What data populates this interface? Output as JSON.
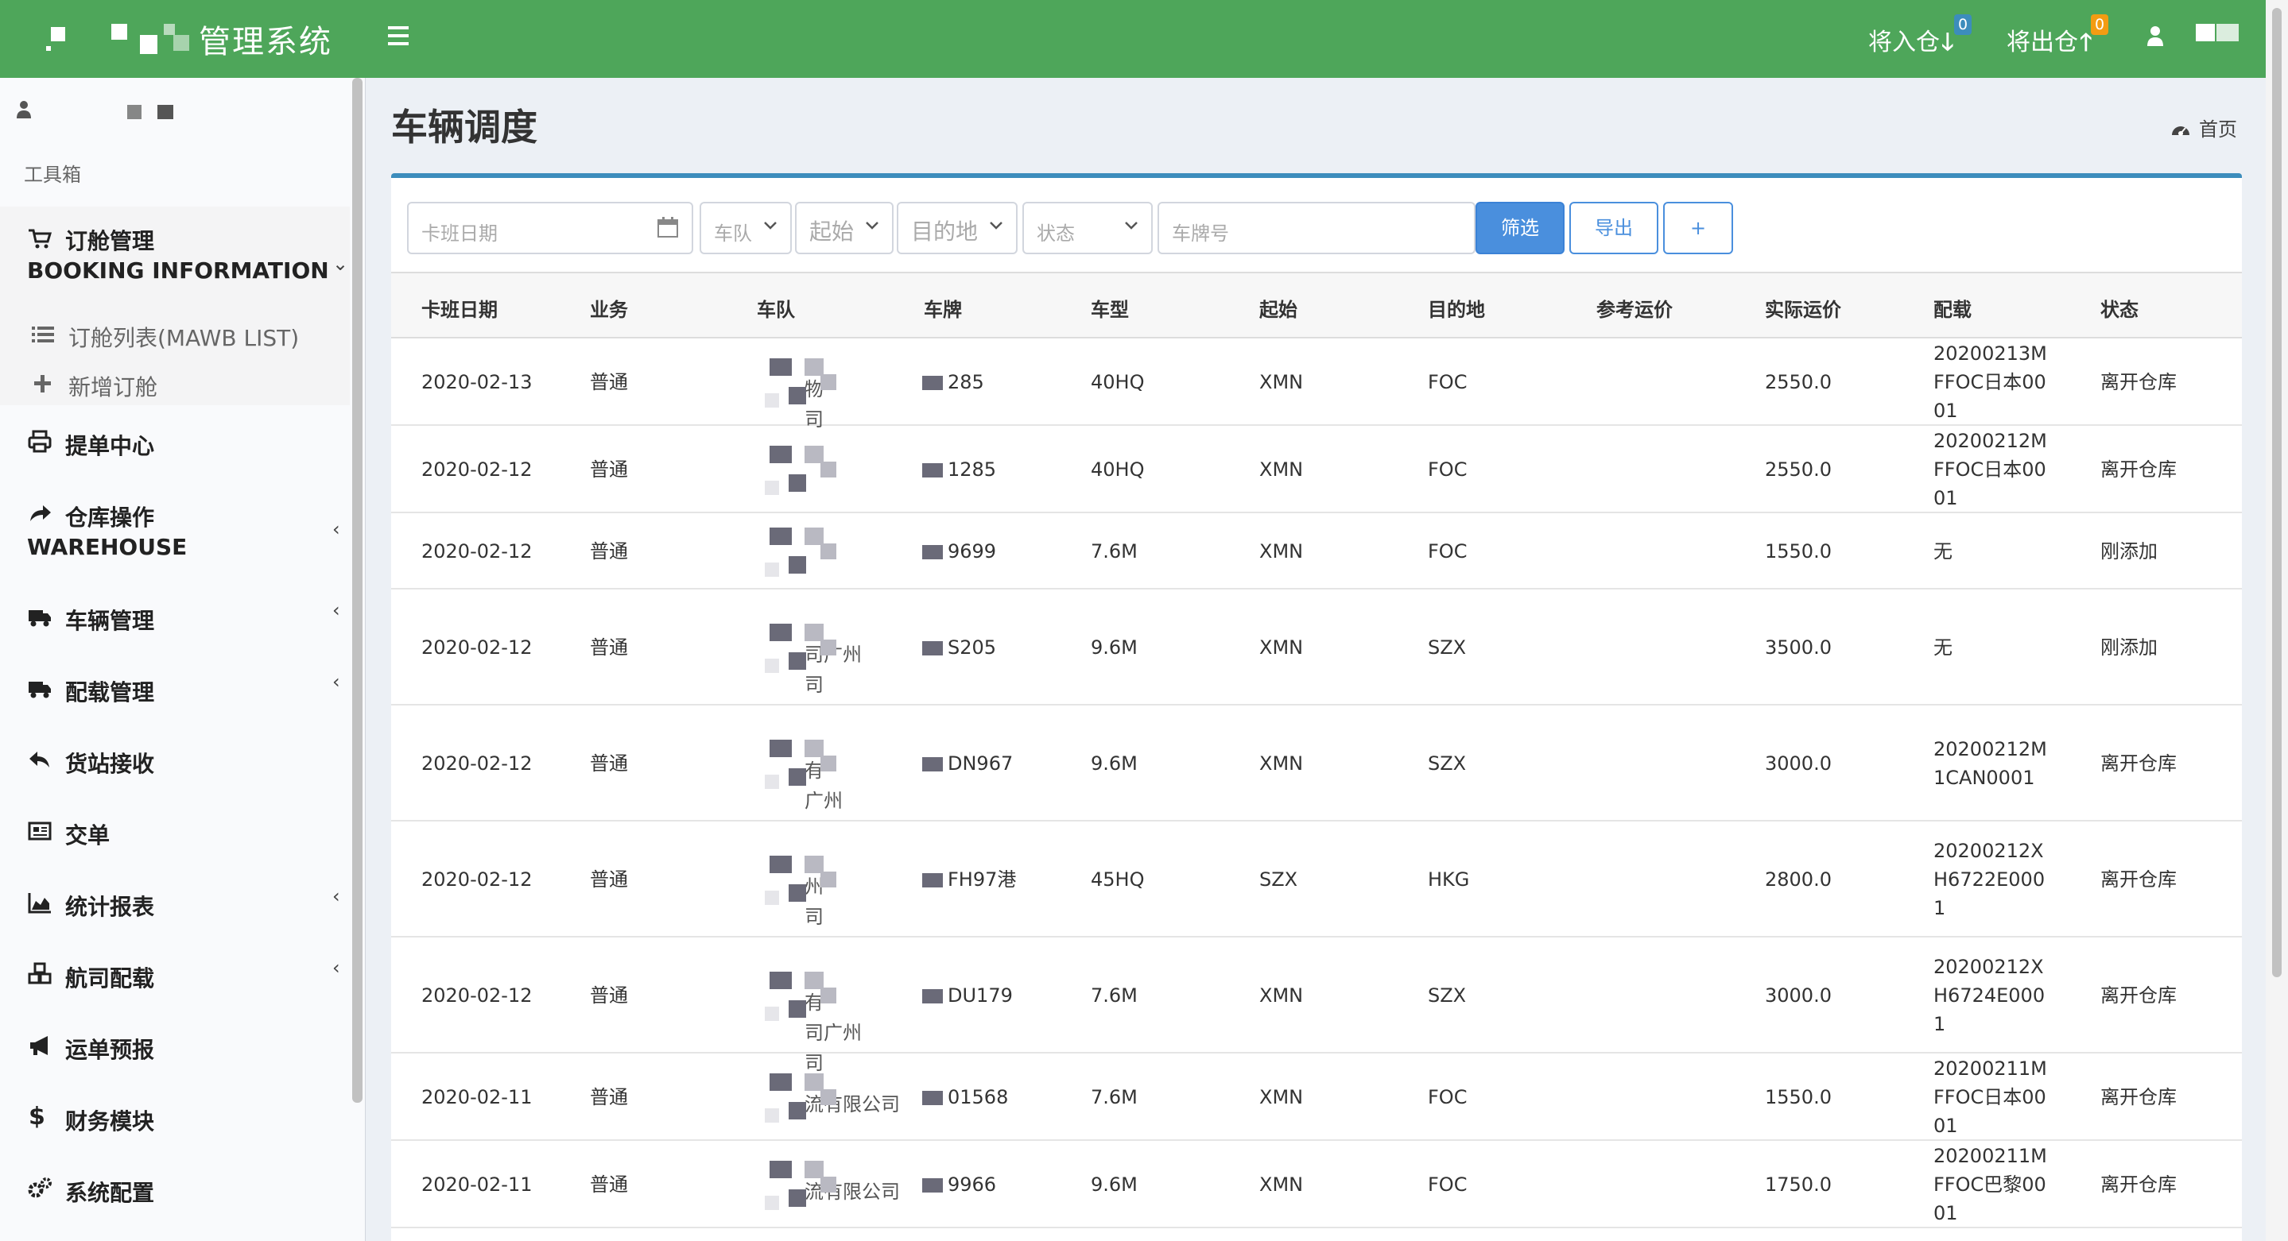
{
  "header": {
    "app_title": "管理系统",
    "nav": {
      "inbound_label": "将入仓",
      "inbound_badge": "0",
      "outbound_label": "将出仓",
      "outbound_badge": "0"
    },
    "colors": {
      "topbar": "#4ea65a",
      "accent": "#3c8dbc",
      "badge_orange": "#f39c12"
    }
  },
  "sidebar": {
    "section_label": "工具箱",
    "booking": {
      "label_cn": "订舱管理",
      "label_en": "BOOKING INFORMATION",
      "icon": "cart-icon"
    },
    "booking_sub": [
      {
        "label": "订舱列表(MAWB LIST)",
        "icon": "list-icon"
      },
      {
        "label": "新增订舱",
        "icon": "plus-icon"
      }
    ],
    "bill_center": {
      "label": "提单中心",
      "icon": "print-icon"
    },
    "warehouse": {
      "label_cn": "仓库操作",
      "label_en": "WAREHOUSE",
      "icon": "share-icon"
    },
    "vehicle": {
      "label": "车辆管理",
      "icon": "truck-icon"
    },
    "loading": {
      "label": "配载管理",
      "icon": "truck-icon"
    },
    "station": {
      "label": "货站接收",
      "icon": "reply-icon"
    },
    "handover": {
      "label": "交单",
      "icon": "newspaper-icon"
    },
    "stats": {
      "label": "统计报表",
      "icon": "area-chart-icon"
    },
    "airline": {
      "label": "航司配载",
      "icon": "cubes-icon"
    },
    "forecast": {
      "label": "运单预报",
      "icon": "bullhorn-icon"
    },
    "finance": {
      "label": "财务模块",
      "icon": "dollar-icon"
    },
    "config": {
      "label": "系统配置",
      "icon": "cogs-icon"
    },
    "chevron_left": "‹",
    "chevron_down": "⌄"
  },
  "page": {
    "title": "车辆调度",
    "breadcrumb_home": "首页"
  },
  "filters": {
    "date_placeholder": "卡班日期",
    "fleet_placeholder": "车队",
    "origin_placeholder": "起始",
    "dest_placeholder": "目的地",
    "status_placeholder": "状态",
    "plate_placeholder": "车牌号",
    "filter_button": "筛选",
    "export_button": "导出",
    "add_button": "+"
  },
  "table": {
    "headers": [
      "卡班日期",
      "业务",
      "车队",
      "车牌",
      "车型",
      "起始",
      "目的地",
      "参考运价",
      "实际运价",
      "配载",
      "状态"
    ],
    "rows": [
      {
        "date": "2020-02-13",
        "biz": "普通",
        "fleet": "物\n司",
        "plate": "285",
        "type": "40HQ",
        "origin": "XMN",
        "dest": "FOC",
        "ref": "",
        "price": "2550.0",
        "load": "20200213M\nFFOC日本00\n01",
        "status": "离开仓库"
      },
      {
        "date": "2020-02-12",
        "biz": "普通",
        "fleet": "",
        "plate": "1285",
        "type": "40HQ",
        "origin": "XMN",
        "dest": "FOC",
        "ref": "",
        "price": "2550.0",
        "load": "20200212M\nFFOC日本00\n01",
        "status": "离开仓库"
      },
      {
        "date": "2020-02-12",
        "biz": "普通",
        "fleet": "",
        "plate": "9699",
        "type": "7.6M",
        "origin": "XMN",
        "dest": "FOC",
        "ref": "",
        "price": "1550.0",
        "load": "无",
        "status": "刚添加"
      },
      {
        "date": "2020-02-12",
        "biz": "普通",
        "fleet": "司广州\n司",
        "plate": "S205",
        "type": "9.6M",
        "origin": "XMN",
        "dest": "SZX",
        "ref": "",
        "price": "3500.0",
        "load": "无",
        "status": "刚添加"
      },
      {
        "date": "2020-02-12",
        "biz": "普通",
        "fleet": "有\n广州",
        "plate": "DN967",
        "type": "9.6M",
        "origin": "XMN",
        "dest": "SZX",
        "ref": "",
        "price": "3000.0",
        "load": "20200212M\n1CAN0001",
        "status": "离开仓库"
      },
      {
        "date": "2020-02-12",
        "biz": "普通",
        "fleet": "州\n司",
        "plate": "FH97港",
        "type": "45HQ",
        "origin": "SZX",
        "dest": "HKG",
        "ref": "",
        "price": "2800.0",
        "load": "20200212X\nH6722E000\n1",
        "status": "离开仓库"
      },
      {
        "date": "2020-02-12",
        "biz": "普通",
        "fleet": "有\n司广州\n司",
        "plate": "DU179",
        "type": "7.6M",
        "origin": "XMN",
        "dest": "SZX",
        "ref": "",
        "price": "3000.0",
        "load": "20200212X\nH6724E000\n1",
        "status": "离开仓库"
      },
      {
        "date": "2020-02-11",
        "biz": "普通",
        "fleet": "流有限公司",
        "plate": "01568",
        "type": "7.6M",
        "origin": "XMN",
        "dest": "FOC",
        "ref": "",
        "price": "1550.0",
        "load": "20200211M\nFFOC日本00\n01",
        "status": "离开仓库"
      },
      {
        "date": "2020-02-11",
        "biz": "普通",
        "fleet": "流有限公司",
        "plate": "9966",
        "type": "9.6M",
        "origin": "XMN",
        "dest": "FOC",
        "ref": "",
        "price": "1750.0",
        "load": "20200211M\nFFOC巴黎00\n01",
        "status": "离开仓库"
      }
    ]
  }
}
